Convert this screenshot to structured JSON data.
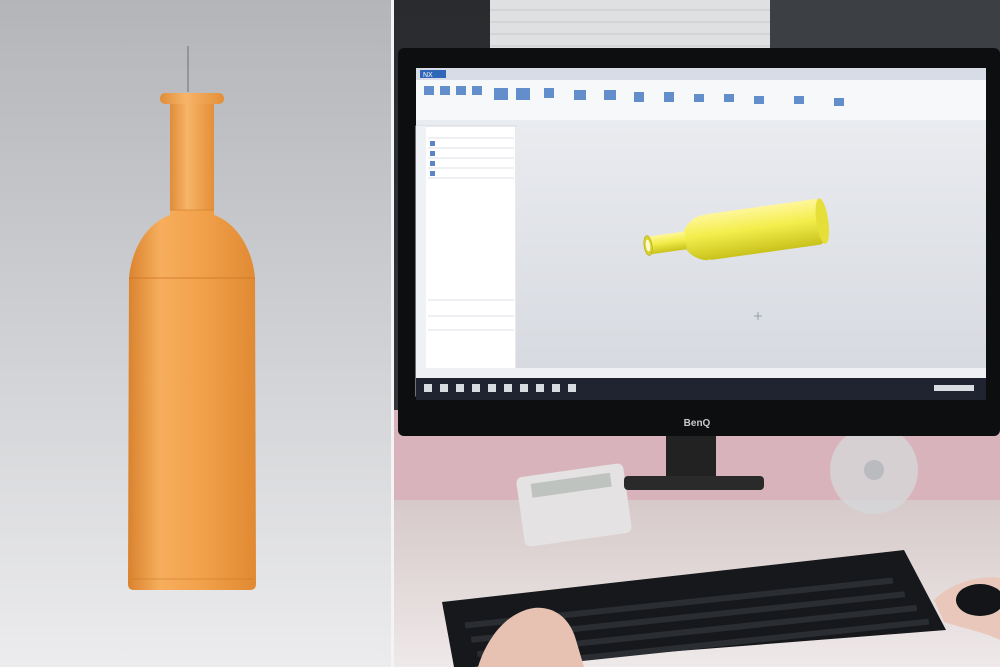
{
  "scene": {
    "left_render": {
      "subject": "bottle-3d-model",
      "bottle_color": "#F2A04A",
      "background_color": "#C8C9CC"
    },
    "workstation": {
      "monitor_brand": "BenQ",
      "cad_app": {
        "title": "NX",
        "model_color": "#F3EE4C",
        "viewport_color": "#E3E5EA"
      },
      "keyboard_color": "#16181b",
      "wall_color": "#D9B3BB"
    }
  }
}
